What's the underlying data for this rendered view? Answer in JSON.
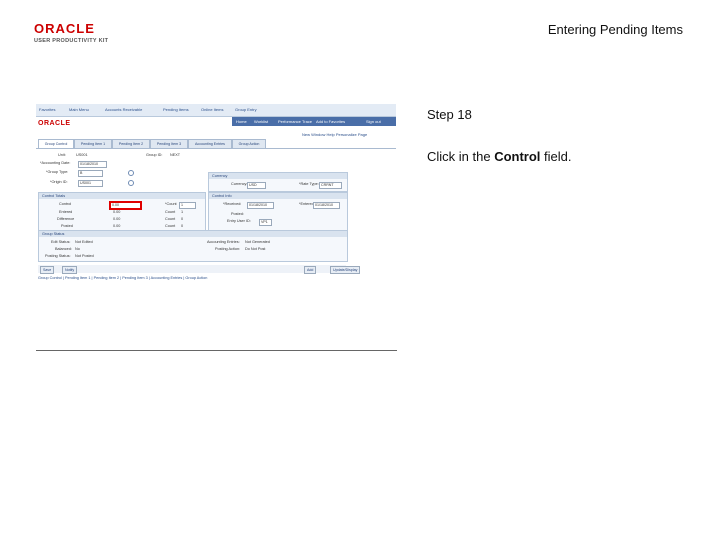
{
  "header": {
    "logo_word": "ORACLE",
    "logo_sub": "USER PRODUCTIVITY KIT",
    "doc_title": "Entering Pending Items"
  },
  "screenshot": {
    "nav": [
      "Favorites",
      "Main Menu",
      "Accounts Receivable",
      "Pending Items",
      "Online Items",
      "Group Entry"
    ],
    "right_links": [
      "Home",
      "Worklist",
      "Performance Trace",
      "Add to Favorites",
      "Sign out"
    ],
    "brand": "ORACLE",
    "page_links": [
      "New Window",
      "Help",
      "Personalize Page"
    ],
    "tabs": [
      "Group Control",
      "Pending Item 1",
      "Pending Item 2",
      "Pending Item 3",
      "Accounting Entries",
      "Group Action"
    ],
    "group": {
      "unit_label": "Unit:",
      "unit_value": "US001",
      "group_label": "Group ID:",
      "group_value": "NEXT",
      "accounting_date_label": "*Accounting Date:",
      "accounting_date_value": "01/18/2010",
      "group_type_label": "*Group Type:",
      "group_type_value": "B",
      "origin_label": "*Origin ID:",
      "origin_value": "US001"
    },
    "currency": {
      "title": "Currency",
      "code_label": "Currency:",
      "code_value": "USD",
      "type_label": "*Rate Type:",
      "type_value": "CRRNT"
    },
    "control_totals": {
      "title": "Control Totals",
      "rows": [
        {
          "label": "Control",
          "amount": "0.00",
          "count_label": "*Count",
          "count": "1"
        },
        {
          "label": "Entered",
          "amount": "0.00",
          "count_label": "Count",
          "count": "1"
        },
        {
          "label": "Difference",
          "amount": "0.00",
          "count_label": "Count",
          "count": "0"
        },
        {
          "label": "Posted",
          "amount": "0.00",
          "count_label": "Count",
          "count": "0"
        }
      ]
    },
    "control_info": {
      "title": "Control Info",
      "received_label": "*Received:",
      "received_value": "01/18/2010",
      "entered_label": "*Entered:",
      "entered_value": "01/18/2010",
      "posted_label": "Posted:",
      "user_label": "Entry User ID:",
      "user_value": "VP1"
    },
    "group_status": {
      "title": "Group Status",
      "edit_label": "Edit Status:",
      "edit_value": "Not Edited",
      "balanced_label": "Balanced:",
      "balanced_value": "No",
      "posting_label": "Posting Status:",
      "posting_value": "Not Posted",
      "acct_label": "Accounting Entries:",
      "acct_value": "Not Generated",
      "post_action_label": "Posting Action:",
      "post_action_value": "Do Not Post"
    },
    "buttons": [
      "Save",
      "Notify",
      "Add",
      "Update/Display"
    ],
    "footer_links": "Group Control | Pending Item 1 | Pending Item 2 | Pending Item 3 | Accounting Entries | Group Action"
  },
  "step": {
    "title": "Step 18",
    "instruction_pre": "Click in the ",
    "instruction_bold": "Control",
    "instruction_post": " field."
  }
}
